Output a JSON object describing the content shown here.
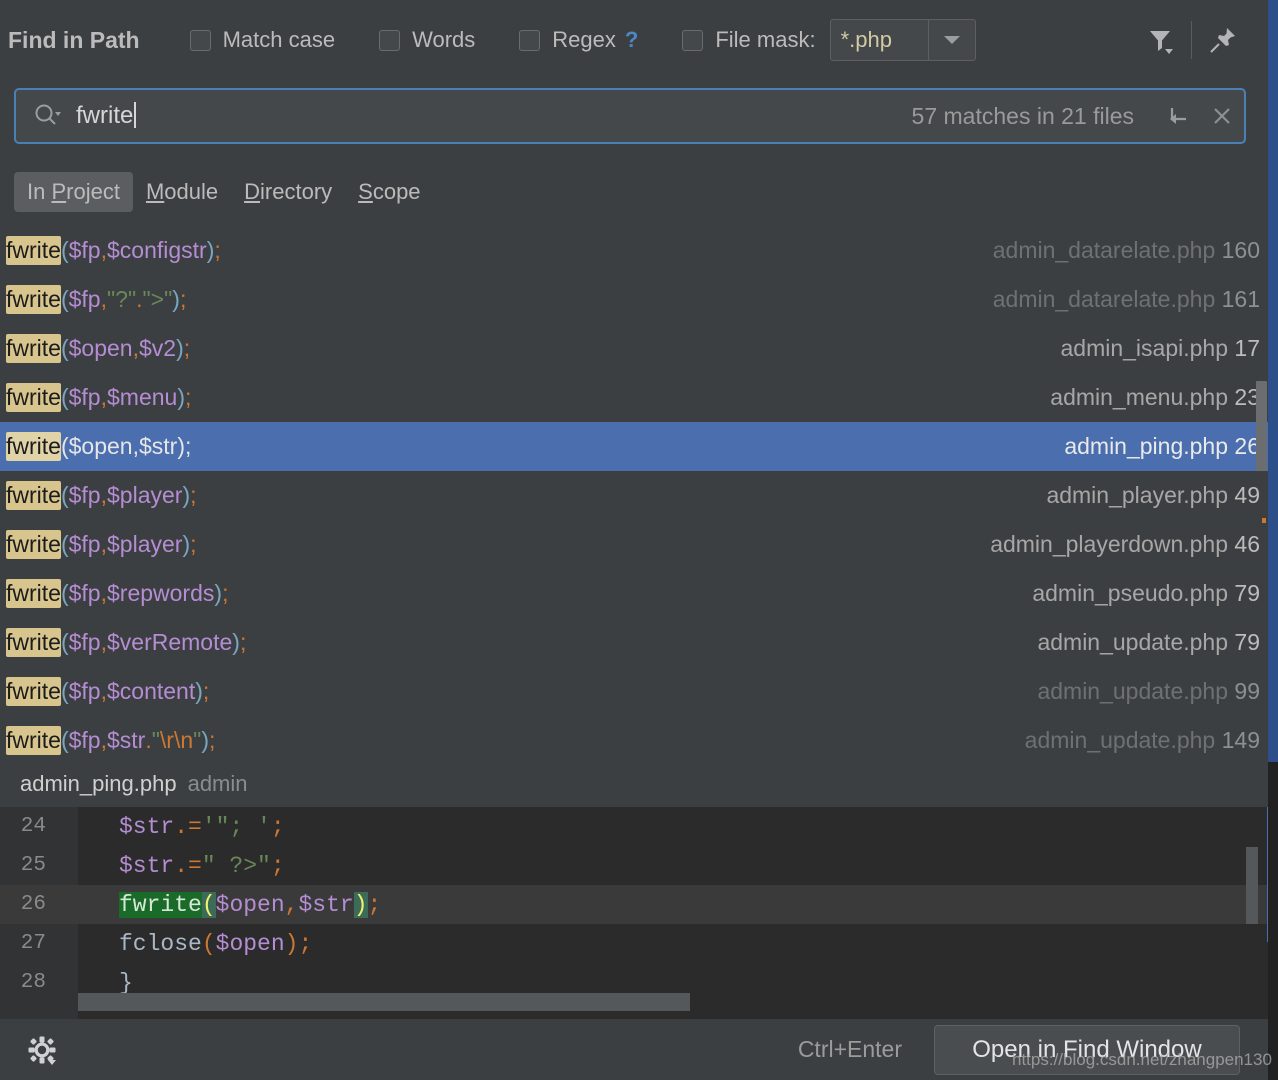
{
  "header": {
    "title": "Find in Path",
    "options": [
      {
        "label": "Match case",
        "checked": false,
        "name": "match-case"
      },
      {
        "label": "Words",
        "checked": false,
        "name": "words"
      },
      {
        "label": "Regex",
        "checked": false,
        "name": "regex",
        "help": "?"
      }
    ],
    "file_mask": {
      "label": "File mask:",
      "checked": false,
      "value": "*.php"
    },
    "icons": {
      "filter": "filter-icon",
      "pin": "pin-icon"
    }
  },
  "search": {
    "icon": "search-icon",
    "value": "fwrite",
    "placeholder": "",
    "match_summary": "57 matches in 21 files",
    "matches": 57,
    "files": 21,
    "history_icon": "search-history-icon",
    "reset_icon": "reset-icon",
    "clear_icon": "close-icon"
  },
  "scope": {
    "tabs": [
      {
        "label": "In Project",
        "mnemonic_index": 3,
        "active": true
      },
      {
        "label": "Module",
        "mnemonic_index": 0,
        "active": false
      },
      {
        "label": "Directory",
        "mnemonic_index": 0,
        "active": false
      },
      {
        "label": "Scope",
        "mnemonic_index": 0,
        "active": false
      }
    ]
  },
  "results": {
    "rows": [
      {
        "match": "fwrite",
        "code_html": "<span class=\"t-punc\">(</span><span class=\"t-var\">$fp</span><span class=\"t-comma\">,</span><span class=\"t-var\">$configstr</span><span class=\"t-punc\">)</span><span class=\"t-semi\">;</span>",
        "file": "admin_datarelate.php",
        "line": "160",
        "dim": true,
        "selected": false
      },
      {
        "match": "fwrite",
        "code_html": "<span class=\"t-punc\">(</span><span class=\"t-var\">$fp</span><span class=\"t-comma\">,</span><span class=\"t-str\">\"?\"</span><span class=\"t-comma\">.</span><span class=\"t-str\">\"&gt;\"</span><span class=\"t-punc\">)</span><span class=\"t-semi\">;</span>",
        "file": "admin_datarelate.php",
        "line": "161",
        "dim": true,
        "selected": false
      },
      {
        "match": "fwrite",
        "code_html": "<span class=\"t-punc\">(</span><span class=\"t-var\">$open</span><span class=\"t-comma\">,</span><span class=\"t-var\">$v2</span><span class=\"t-punc\">)</span><span class=\"t-semi\">;</span>",
        "file": "admin_isapi.php",
        "line": "17",
        "dim": false,
        "selected": false
      },
      {
        "match": "fwrite",
        "code_html": "<span class=\"t-punc\">(</span><span class=\"t-var\">$fp</span><span class=\"t-comma\">,</span><span class=\"t-var\">$menu</span><span class=\"t-punc\">)</span><span class=\"t-semi\">;</span>",
        "file": "admin_menu.php",
        "line": "23",
        "dim": false,
        "selected": false
      },
      {
        "match": "fwrite",
        "code_html": "<span class=\"t-punc\">(</span><span class=\"t-var\">$open</span><span class=\"t-comma\">,</span><span class=\"t-var\">$str</span><span class=\"t-punc\">)</span><span class=\"t-semi\">;</span>",
        "file": "admin_ping.php",
        "line": "26",
        "dim": false,
        "selected": true
      },
      {
        "match": "fwrite",
        "code_html": "<span class=\"t-punc\">(</span><span class=\"t-var\">$fp</span><span class=\"t-comma\">,</span><span class=\"t-var\">$player</span><span class=\"t-punc\">)</span><span class=\"t-semi\">;</span>",
        "file": "admin_player.php",
        "line": "49",
        "dim": false,
        "selected": false
      },
      {
        "match": "fwrite",
        "code_html": "<span class=\"t-punc\">(</span><span class=\"t-var\">$fp</span><span class=\"t-comma\">,</span><span class=\"t-var\">$player</span><span class=\"t-punc\">)</span><span class=\"t-semi\">;</span>",
        "file": "admin_playerdown.php",
        "line": "46",
        "dim": false,
        "selected": false
      },
      {
        "match": "fwrite",
        "code_html": "<span class=\"t-punc\">(</span><span class=\"t-var\">$fp</span><span class=\"t-comma\">,</span> <span class=\"t-var\">$repwords</span><span class=\"t-punc\">)</span><span class=\"t-semi\">;</span>",
        "file": "admin_pseudo.php",
        "line": "79",
        "dim": false,
        "selected": false
      },
      {
        "match": "fwrite",
        "code_html": "<span class=\"t-punc\">(</span><span class=\"t-var\">$fp</span><span class=\"t-comma\">,</span><span class=\"t-var\">$verRemote</span><span class=\"t-punc\">)</span><span class=\"t-semi\">;</span>",
        "file": "admin_update.php",
        "line": "79",
        "dim": false,
        "selected": false
      },
      {
        "match": "fwrite",
        "code_html": "<span class=\"t-punc\">(</span><span class=\"t-var\">$fp</span><span class=\"t-comma\">,</span><span class=\"t-var\">$content</span><span class=\"t-punc\">)</span><span class=\"t-semi\">;</span>",
        "file": "admin_update.php",
        "line": "99",
        "dim": true,
        "selected": false
      },
      {
        "match": "fwrite",
        "code_html": "<span class=\"t-punc\">(</span><span class=\"t-var\">$fp</span><span class=\"t-comma\">,</span><span class=\"t-var\">$str</span><span class=\"t-comma\">.</span><span class=\"t-str\">\"</span><span class=\"t-esc\">\\r\\n</span><span class=\"t-str\">\"</span><span class=\"t-punc\">)</span><span class=\"t-semi\">;</span>",
        "file": "admin_update.php",
        "line": "149",
        "dim": true,
        "selected": false
      }
    ]
  },
  "preview": {
    "file": "admin_ping.php",
    "directory": "admin",
    "lines": [
      {
        "no": "24",
        "html": "<span class=\"c-var\">$str</span><span class=\"c-op\">.=</span><span class=\"c-str\">'\"; '</span><span class=\"c-op\">;</span>",
        "match": false
      },
      {
        "no": "25",
        "html": "<span class=\"c-var\">$str</span><span class=\"c-op\">.=</span><span class=\"c-str\">\" ?&gt;\"</span><span class=\"c-op\">;</span>",
        "match": false
      },
      {
        "no": "26",
        "html": "<span class=\"c-hit\">fwrite</span><span class=\"c-brace-hl\">(</span><span class=\"c-var\">$open</span><span class=\"c-op\">,</span><span class=\"c-var\">$str</span><span class=\"c-brace-hl\">)</span><span class=\"c-op\">;</span>",
        "match": true
      },
      {
        "no": "27",
        "html": "<span class=\"c-fn\">fclose</span><span class=\"c-par\">(</span><span class=\"c-var\">$open</span><span class=\"c-par\">)</span><span class=\"c-op\">;</span>",
        "match": false
      },
      {
        "no": "28",
        "html": "<span class=\"c-fn\">}</span>",
        "match": false
      }
    ]
  },
  "bottom": {
    "settings_icon": "gear-icon",
    "shortcut": "Ctrl+Enter",
    "primary_button": "Open in Find Window"
  },
  "watermark": "https://blog.csdn.net/zhangpen130",
  "colors": {
    "accent": "#4b6eaf",
    "focus_border": "#4b80b5",
    "highlight": "#d8c58d",
    "panel_bg": "#3c3f41",
    "editor_bg": "#2b2b2b"
  }
}
